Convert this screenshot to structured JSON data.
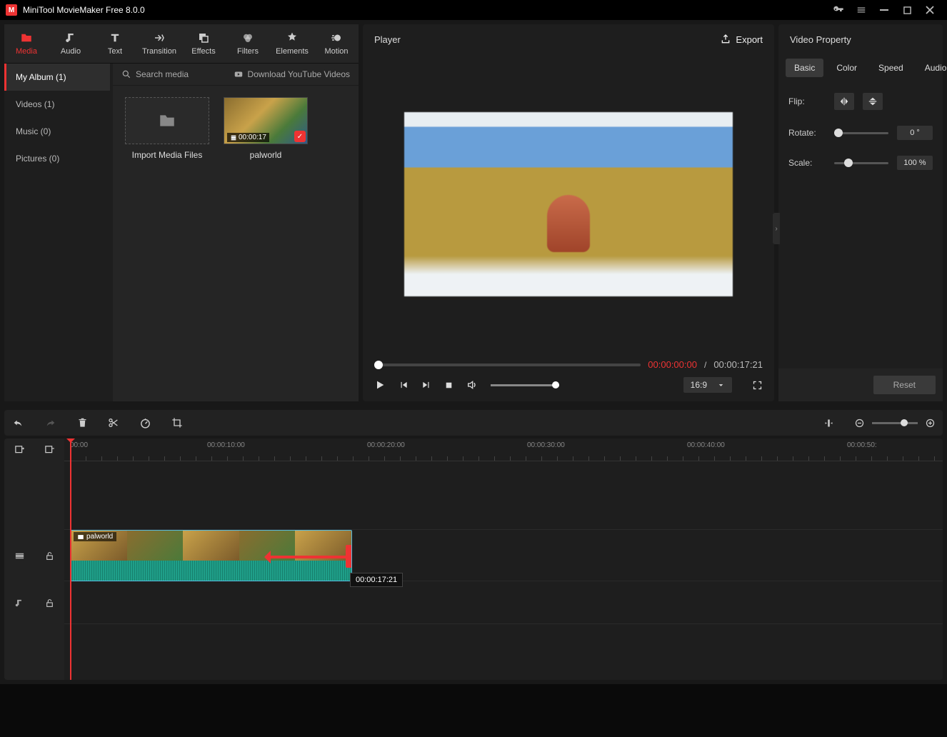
{
  "app": {
    "title": "MiniTool MovieMaker Free 8.0.0"
  },
  "toolbar": {
    "tabs": [
      {
        "label": "Media",
        "icon": "folder"
      },
      {
        "label": "Audio",
        "icon": "music"
      },
      {
        "label": "Text",
        "icon": "text"
      },
      {
        "label": "Transition",
        "icon": "transition"
      },
      {
        "label": "Effects",
        "icon": "effects"
      },
      {
        "label": "Filters",
        "icon": "filters"
      },
      {
        "label": "Elements",
        "icon": "elements"
      },
      {
        "label": "Motion",
        "icon": "motion"
      }
    ]
  },
  "media": {
    "nav": [
      {
        "label": "My Album (1)",
        "active": true
      },
      {
        "label": "Videos (1)"
      },
      {
        "label": "Music (0)"
      },
      {
        "label": "Pictures (0)"
      }
    ],
    "search_placeholder": "Search media",
    "download_label": "Download YouTube Videos",
    "import_label": "Import Media Files",
    "clip": {
      "name": "palworld",
      "duration": "00:00:17"
    }
  },
  "player": {
    "title": "Player",
    "export_label": "Export",
    "current_time": "00:00:00:00",
    "total_time": "00:00:17:21",
    "aspect": "16:9"
  },
  "props": {
    "title": "Video Property",
    "tabs": [
      "Basic",
      "Color",
      "Speed",
      "Audio"
    ],
    "flip_label": "Flip:",
    "rotate_label": "Rotate:",
    "rotate_value": "0 °",
    "scale_label": "Scale:",
    "scale_value": "100 %",
    "reset_label": "Reset"
  },
  "timeline": {
    "ticks": [
      "00:00",
      "00:00:10:00",
      "00:00:20:00",
      "00:00:30:00",
      "00:00:40:00",
      "00:00:50:"
    ],
    "clip_name": "palworld",
    "trim_time": "00:00:17:21"
  }
}
